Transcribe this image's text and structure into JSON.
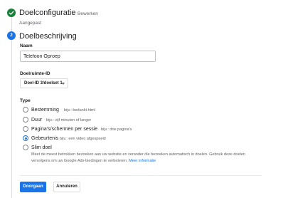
{
  "step1": {
    "title": "Doelconfiguratie",
    "edit_label": "Bewerken",
    "status": "Aangepast",
    "icon": "check-icon",
    "color": "#188038"
  },
  "step2": {
    "number": "2",
    "title": "Doelbeschrijving",
    "color": "#1a73e8"
  },
  "name_field": {
    "label": "Naam",
    "value": "Telefoon Oproep",
    "placeholder": ""
  },
  "slot_id": {
    "label": "Doelruimte-ID",
    "selected": "Doel-ID 3/doelset 1"
  },
  "type": {
    "label": "Type",
    "options": [
      {
        "label": "Bestemming",
        "hint": "bijv.: bedankt.html",
        "selected": false
      },
      {
        "label": "Duur",
        "hint": "bijv.: vijf minuten of langer",
        "selected": false
      },
      {
        "label": "Pagina's/schermen per sessie",
        "hint": "bijv.: drie pagina's",
        "selected": false
      },
      {
        "label": "Gebeurtenis",
        "hint": "bijv.: een video afgespeeld",
        "selected": true
      },
      {
        "label": "Slim doel",
        "hint": "",
        "selected": false
      }
    ],
    "smart_description": "Meet de meest betrokken bezoeken aan uw website en verander die bezoeken automatisch in doelen. Gebruik deze doelen vervolgens om uw Google Ads-biedingen te verbeteren.",
    "smart_link": "Meer informatie"
  },
  "actions": {
    "continue": "Doorgaan",
    "cancel": "Annuleren"
  }
}
